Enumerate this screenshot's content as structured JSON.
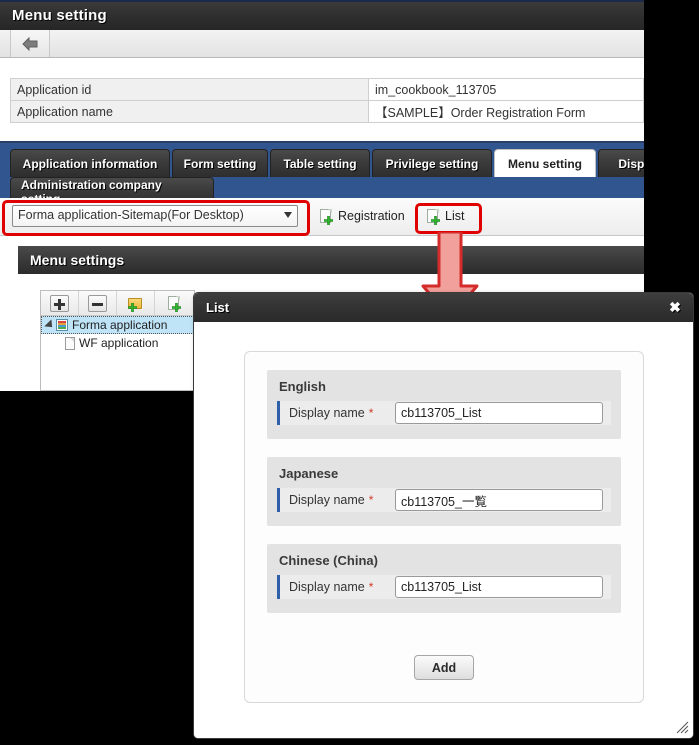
{
  "window": {
    "title": "Menu setting",
    "back_icon": "arrow-left-icon"
  },
  "info": {
    "rows": [
      {
        "label": "Application id",
        "value": "im_cookbook_113705"
      },
      {
        "label": "Application name",
        "value": "【SAMPLE】Order Registration Form"
      }
    ]
  },
  "tabs": {
    "row1": [
      {
        "label": "Application information",
        "active": false
      },
      {
        "label": "Form setting",
        "active": false
      },
      {
        "label": "Table setting",
        "active": false
      },
      {
        "label": "Privilege setting",
        "active": false
      },
      {
        "label": "Menu setting",
        "active": true
      },
      {
        "label": "Displ",
        "active": false
      }
    ],
    "row2": [
      {
        "label": "Administration company setting",
        "active": false
      }
    ]
  },
  "toolbar": {
    "select_value": "Forma application-Sitemap(For Desktop)",
    "registration_label": "Registration",
    "list_label": "List"
  },
  "section": {
    "menu_settings_title": "Menu settings"
  },
  "tree": {
    "toolbar_buttons": [
      "expand-all-icon",
      "collapse-all-icon",
      "add-folder-icon",
      "add-page-icon"
    ],
    "nodes": [
      {
        "label": "Forma application",
        "selected": true
      },
      {
        "label": "WF application",
        "selected": false
      }
    ]
  },
  "dialog": {
    "title": "List",
    "close_label": "✖",
    "groups": [
      {
        "language": "English",
        "field_label": "Display name",
        "required_mark": "*",
        "value": "cb113705_List"
      },
      {
        "language": "Japanese",
        "field_label": "Display name",
        "required_mark": "*",
        "value": "cb113705_一覧"
      },
      {
        "language": "Chinese (China)",
        "field_label": "Display name",
        "required_mark": "*",
        "value": "cb113705_List"
      }
    ],
    "add_label": "Add"
  },
  "annotations": {
    "highlight_color": "#e00000",
    "arrow_fill": "#f09a96",
    "arrow_stroke": "#cc2222"
  }
}
